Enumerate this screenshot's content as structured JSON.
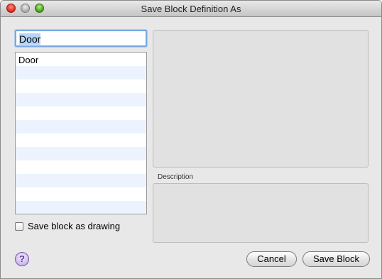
{
  "window": {
    "title": "Save Block Definition As"
  },
  "name_field": {
    "value": "Door"
  },
  "block_list": {
    "items": [
      "Door",
      "",
      "",
      "",
      "",
      "",
      "",
      "",
      "",
      "",
      "",
      ""
    ]
  },
  "description": {
    "label": "Description"
  },
  "save_as_drawing": {
    "label": "Save block as drawing",
    "checked": false
  },
  "buttons": {
    "help": "?",
    "cancel": "Cancel",
    "save": "Save Block"
  },
  "icons": [
    "close-window-icon",
    "minimize-window-icon",
    "zoom-window-icon",
    "help-icon",
    "checkbox-icon"
  ]
}
